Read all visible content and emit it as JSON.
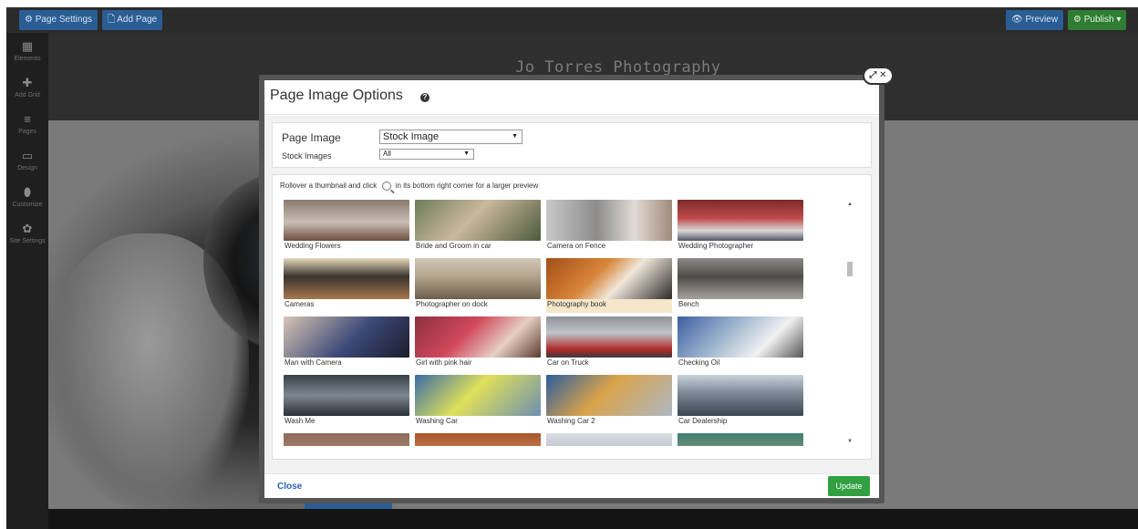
{
  "topbar": {
    "page_settings": "⚙ Page Settings",
    "add_page": "🗋 Add Page",
    "preview": "👁 Preview",
    "publish": "⚙ Publish ▾"
  },
  "sidebar": {
    "items": [
      {
        "icon": "grid-icon",
        "glyph": "▦",
        "label": "Elements"
      },
      {
        "icon": "plus-icon",
        "glyph": "✚",
        "label": "Add Grid"
      },
      {
        "icon": "pages-icon",
        "glyph": "≡",
        "label": "Pages"
      },
      {
        "icon": "monitor-icon",
        "glyph": "▭",
        "label": "Design"
      },
      {
        "icon": "drop-icon",
        "glyph": "⬮",
        "label": "Customize"
      },
      {
        "icon": "gear-icon",
        "glyph": "✿",
        "label": "Site Settings"
      }
    ]
  },
  "site": {
    "title": "Jo Torres Photography"
  },
  "modal": {
    "title": "Page Image Options",
    "help": "?",
    "close_x": "⤢ ✕",
    "page_image_label": "Page Image",
    "page_image_value": "Stock Image",
    "stock_images_label": "Stock Images",
    "stock_images_value": "All",
    "hint_before": "Rollover a thumbnail and click",
    "hint_after": "in its bottom right corner for a larger preview",
    "close_link": "Close",
    "update_button": "Update",
    "selected_index": 6,
    "thumbnails": [
      {
        "caption": "Wedding Flowers"
      },
      {
        "caption": "Bride and Groom in car"
      },
      {
        "caption": "Camera on Fence"
      },
      {
        "caption": "Wedding Photographer"
      },
      {
        "caption": "Cameras"
      },
      {
        "caption": "Photographer on dock"
      },
      {
        "caption": "Photography book"
      },
      {
        "caption": "Bench"
      },
      {
        "caption": "Man with Camera"
      },
      {
        "caption": "Girl with pink hair"
      },
      {
        "caption": "Car on Truck"
      },
      {
        "caption": "Checking Oil"
      },
      {
        "caption": "Wash Me"
      },
      {
        "caption": "Washing Car"
      },
      {
        "caption": "Washing Car 2"
      },
      {
        "caption": "Car Dealership"
      },
      {
        "caption": ""
      },
      {
        "caption": ""
      },
      {
        "caption": ""
      },
      {
        "caption": ""
      }
    ]
  }
}
